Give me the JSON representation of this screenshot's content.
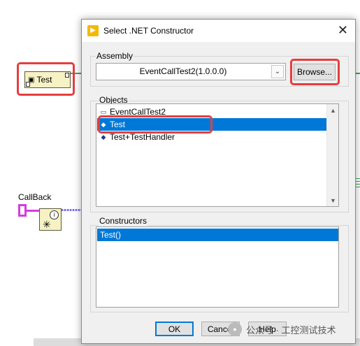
{
  "background": {
    "test_node_label": "Test",
    "callback_label": "CallBack"
  },
  "dialog": {
    "title": "Select .NET Constructor",
    "assembly": {
      "label": "Assembly",
      "value": "EventCallTest2(1.0.0.0)",
      "browse_label": "Browse..."
    },
    "objects": {
      "label": "Objects",
      "items": [
        {
          "label": "EventCallTest2",
          "icon": "namespace-icon",
          "selected": false
        },
        {
          "label": "Test",
          "icon": "class-icon",
          "selected": true
        },
        {
          "label": "Test+TestHandler",
          "icon": "class-icon",
          "selected": false
        }
      ]
    },
    "constructors": {
      "label": "Constructors",
      "items": [
        {
          "label": "Test()",
          "selected": true
        }
      ]
    },
    "buttons": {
      "ok": "OK",
      "cancel": "Cancel",
      "help": "Help"
    }
  },
  "watermark": {
    "text": "公众号 · 工控测试技术"
  },
  "colors": {
    "selection": "#0078d7",
    "highlight": "#e53e3e",
    "app_icon": "#f5b800"
  }
}
